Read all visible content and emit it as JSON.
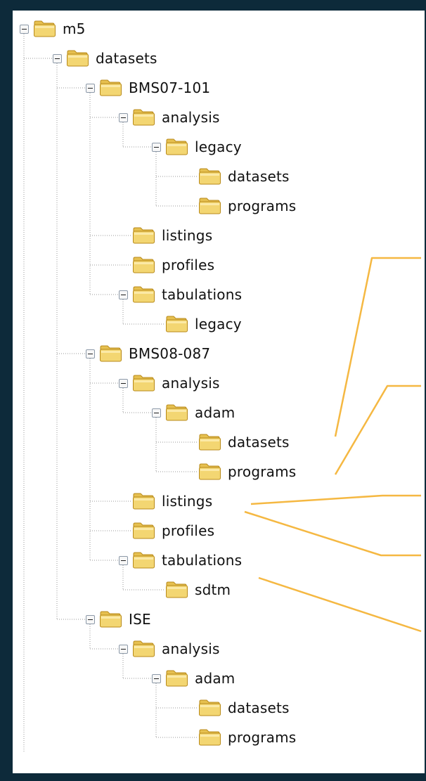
{
  "tree": [
    {
      "id": "m5",
      "label": "m5",
      "depth": 0,
      "expanded": true
    },
    {
      "id": "datasets",
      "label": "datasets",
      "depth": 1,
      "expanded": true
    },
    {
      "id": "bms07-101",
      "label": "BMS07-101",
      "depth": 2,
      "expanded": true
    },
    {
      "id": "bms07-analysis",
      "label": "analysis",
      "depth": 3,
      "expanded": true
    },
    {
      "id": "bms07-legacy",
      "label": "legacy",
      "depth": 4,
      "expanded": true
    },
    {
      "id": "bms07-legacy-datasets",
      "label": "datasets",
      "depth": 5,
      "expanded": false
    },
    {
      "id": "bms07-legacy-programs",
      "label": "programs",
      "depth": 5,
      "expanded": false
    },
    {
      "id": "bms07-listings",
      "label": "listings",
      "depth": 3,
      "expanded": false
    },
    {
      "id": "bms07-profiles",
      "label": "profiles",
      "depth": 3,
      "expanded": false
    },
    {
      "id": "bms07-tabulations",
      "label": "tabulations",
      "depth": 3,
      "expanded": true
    },
    {
      "id": "bms07-tab-legacy",
      "label": "legacy",
      "depth": 4,
      "expanded": false
    },
    {
      "id": "bms08-087",
      "label": "BMS08-087",
      "depth": 2,
      "expanded": true
    },
    {
      "id": "bms08-analysis",
      "label": "analysis",
      "depth": 3,
      "expanded": true
    },
    {
      "id": "bms08-adam",
      "label": "adam",
      "depth": 4,
      "expanded": true
    },
    {
      "id": "bms08-adam-datasets",
      "label": "datasets",
      "depth": 5,
      "expanded": false
    },
    {
      "id": "bms08-adam-programs",
      "label": "programs",
      "depth": 5,
      "expanded": false
    },
    {
      "id": "bms08-listings",
      "label": "listings",
      "depth": 3,
      "expanded": false
    },
    {
      "id": "bms08-profiles",
      "label": "profiles",
      "depth": 3,
      "expanded": false
    },
    {
      "id": "bms08-tabulations",
      "label": "tabulations",
      "depth": 3,
      "expanded": true
    },
    {
      "id": "bms08-sdtm",
      "label": "sdtm",
      "depth": 4,
      "expanded": false
    },
    {
      "id": "ise",
      "label": "ISE",
      "depth": 2,
      "expanded": true
    },
    {
      "id": "ise-analysis",
      "label": "analysis",
      "depth": 3,
      "expanded": true
    },
    {
      "id": "ise-adam",
      "label": "adam",
      "depth": 4,
      "expanded": true
    },
    {
      "id": "ise-adam-datasets",
      "label": "datasets",
      "depth": 5,
      "expanded": false
    },
    {
      "id": "ise-adam-programs",
      "label": "programs",
      "depth": 5,
      "expanded": false
    }
  ],
  "colors": {
    "background": "#0d2a3a",
    "panel": "#ffffff",
    "callout_line": "#f5b842",
    "folder_fill": "#f3d672",
    "folder_tab": "#e6c050",
    "folder_stroke": "#b88a1a",
    "tree_line": "#9a9a9a"
  },
  "icons": {
    "folder": "folder-icon",
    "expand_toggle": "minus-box-icon"
  }
}
